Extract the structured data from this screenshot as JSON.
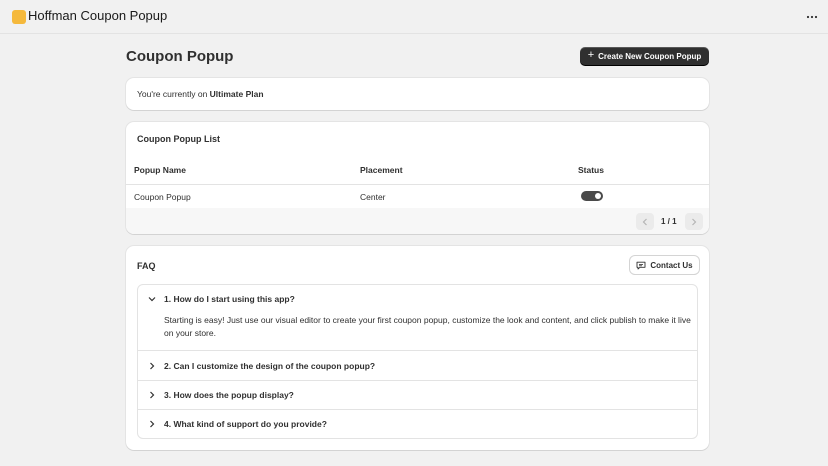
{
  "app": {
    "title": "Hoffman Coupon Popup",
    "logo_color": "#f5b93c"
  },
  "header": {
    "more_icon": "ellipsis-horizontal-icon"
  },
  "page": {
    "title": "Coupon Popup",
    "create_button": "Create New Coupon Popup"
  },
  "plan": {
    "prefix": "You're currently on ",
    "name": "Ultimate Plan"
  },
  "popup_list": {
    "title": "Coupon Popup List",
    "columns": [
      "Popup Name",
      "Placement",
      "Status"
    ],
    "rows": [
      {
        "name": "Coupon Popup",
        "placement": "Center",
        "status_enabled": true
      }
    ],
    "pagination": {
      "text": "1 / 1"
    }
  },
  "faq": {
    "title": "FAQ",
    "contact_button": "Contact Us",
    "items": [
      {
        "question": "1. How do I start using this app?",
        "expanded": true,
        "answer": "Starting is easy! Just use our visual editor to create your first coupon popup, customize the look and content, and click publish to make it live on your store."
      },
      {
        "question": "2. Can I customize the design of the coupon popup?",
        "expanded": false
      },
      {
        "question": "3. How does the popup display?",
        "expanded": false
      },
      {
        "question": "4. What kind of support do you provide?",
        "expanded": false
      }
    ]
  },
  "colors": {
    "primary_button": "#303030",
    "background": "#f1f1f1",
    "toggle_on": "#4a4a4a"
  }
}
